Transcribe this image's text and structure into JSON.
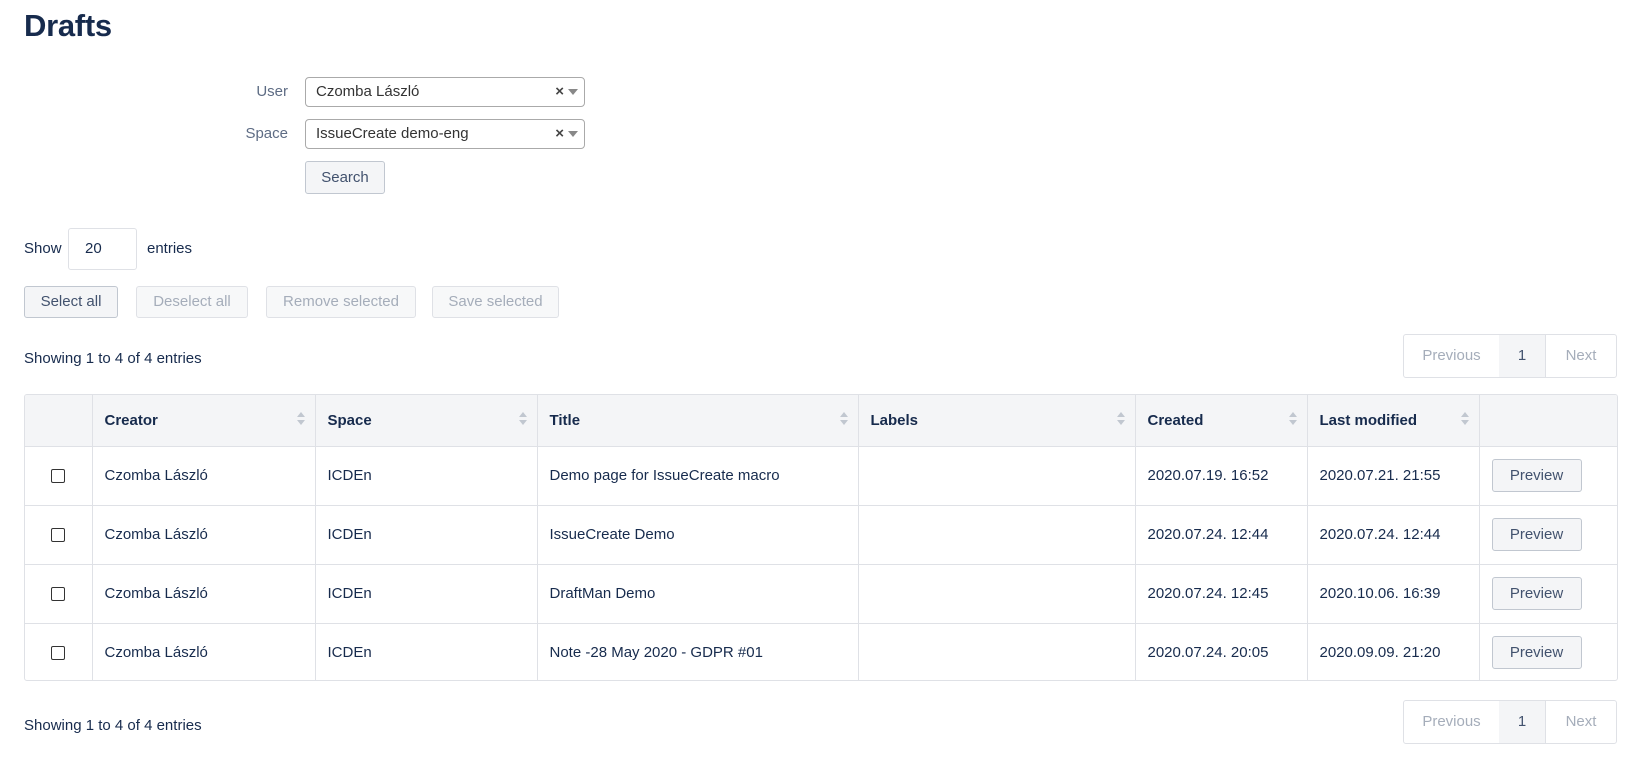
{
  "page": {
    "title": "Drafts"
  },
  "filters": {
    "user": {
      "label": "User",
      "value": "Czomba László",
      "clear": "×"
    },
    "space": {
      "label": "Space",
      "value": "IssueCreate demo-eng",
      "clear": "×"
    },
    "search_label": "Search"
  },
  "length": {
    "prefix": "Show",
    "value": "20",
    "suffix": "entries"
  },
  "actions": {
    "select_all": "Select all",
    "deselect_all": "Deselect all",
    "remove_selected": "Remove selected",
    "save_selected": "Save selected"
  },
  "info": {
    "top": "Showing 1 to 4 of 4 entries",
    "bottom": "Showing 1 to 4 of 4 entries"
  },
  "pagination": {
    "previous": "Previous",
    "current": "1",
    "next": "Next"
  },
  "table": {
    "headers": [
      "Creator",
      "Space",
      "Title",
      "Labels",
      "Created",
      "Last modified"
    ],
    "rows": [
      {
        "creator": "Czomba László",
        "space": "ICDEn",
        "title": "Demo page for IssueCreate macro",
        "labels": "",
        "created": "2020.07.19. 16:52",
        "modified": "2020.07.21. 21:55",
        "action": "Preview"
      },
      {
        "creator": "Czomba László",
        "space": "ICDEn",
        "title": "IssueCreate Demo",
        "labels": "",
        "created": "2020.07.24. 12:44",
        "modified": "2020.07.24. 12:44",
        "action": "Preview"
      },
      {
        "creator": "Czomba László",
        "space": "ICDEn",
        "title": "DraftMan Demo",
        "labels": "",
        "created": "2020.07.24. 12:45",
        "modified": "2020.10.06. 16:39",
        "action": "Preview"
      },
      {
        "creator": "Czomba László",
        "space": "ICDEn",
        "title": "Note -28 May 2020 - GDPR #01",
        "labels": "",
        "created": "2020.07.24. 20:05",
        "modified": "2020.09.09. 21:20",
        "action": "Preview"
      }
    ]
  }
}
